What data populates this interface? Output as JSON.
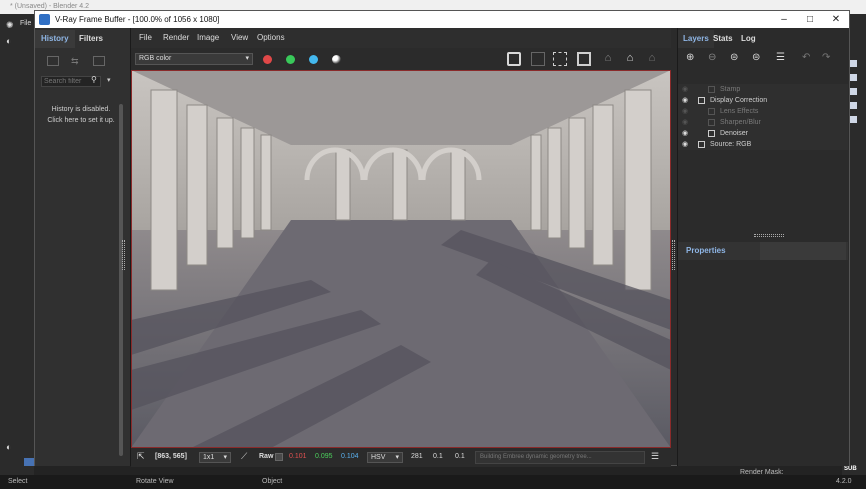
{
  "blender": {
    "title": "* (Unsaved) - Blender 4.2",
    "status_select": "Select",
    "status_rotate": "Rotate View",
    "status_object": "Object",
    "render_mask": "Render Mask:",
    "version": "4.2.0",
    "file_menu": "File",
    "sub_label": "SUB"
  },
  "vfb": {
    "title": "V-Ray Frame Buffer - [100.0% of 1056 x 1080]",
    "menu": [
      "File",
      "Render",
      "Image",
      "View",
      "Options"
    ],
    "channel_select": "RGB color",
    "dot_colors": [
      "#e04848",
      "#39c95a",
      "#44b8ee"
    ]
  },
  "left_panel": {
    "tab_history": "History",
    "tab_filters": "Filters",
    "search_placeholder": "Search filter",
    "history_disabled": "History is disabled.",
    "history_setup": "Click here to set it up."
  },
  "right_panel": {
    "tab_layers": "Layers",
    "tab_stats": "Stats",
    "tab_log": "Log",
    "layers": [
      {
        "label": "Stamp",
        "enabled": false
      },
      {
        "label": "Display Correction",
        "enabled": true
      },
      {
        "label": "Lens Effects",
        "enabled": false
      },
      {
        "label": "Sharpen/Blur",
        "enabled": false
      },
      {
        "label": "Denoiser",
        "enabled": true
      },
      {
        "label": "Source: RGB",
        "enabled": true
      }
    ],
    "properties_title": "Properties"
  },
  "bottom_bar": {
    "coords": "[863, 565]",
    "zoom": "1x1",
    "raw_label": "Raw",
    "r": "0.101",
    "g": "0.095",
    "b": "0.104",
    "color_mode": "HSV",
    "h": "281",
    "s": "0.1",
    "v": "0.1",
    "status": "Building Embree dynamic geometry tree..."
  }
}
